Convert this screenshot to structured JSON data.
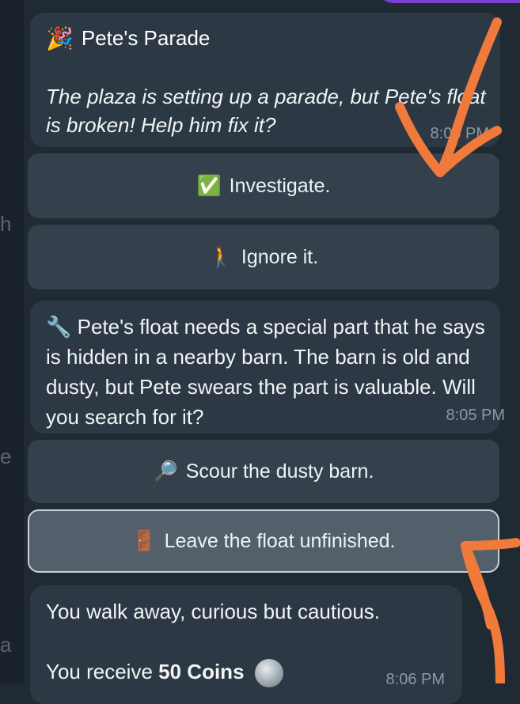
{
  "left_edge": {
    "char_top": "h",
    "char_mid": "e",
    "char_bottom": "a"
  },
  "messages": [
    {
      "id": "m1",
      "title": "Pete's Parade",
      "title_emoji": "🎉",
      "body": "The plaza is setting up a parade, but Pete's float is broken! Help him fix it?",
      "time": "8:05 PM"
    },
    {
      "id": "m2",
      "emoji": "🔧",
      "body": "Pete's float needs a special part that he says is hidden in a nearby barn. The barn is old and dusty, but Pete swears the part is valuable. Will you search for it?",
      "time": "8:05 PM"
    },
    {
      "id": "m3",
      "line1": "You walk away, curious but cautious.",
      "line2_prefix": "You receive",
      "line2_bold": "50 Coins",
      "time": "8:06 PM"
    }
  ],
  "buttons": [
    {
      "emoji": "✅",
      "label": "Investigate."
    },
    {
      "emoji": "🚶",
      "label": "Ignore it."
    },
    {
      "emoji": "🔎",
      "label": "Scour the dusty barn."
    },
    {
      "emoji": "🚪",
      "label": "Leave the float unfinished."
    }
  ],
  "annotation_color": "#f07a3c"
}
